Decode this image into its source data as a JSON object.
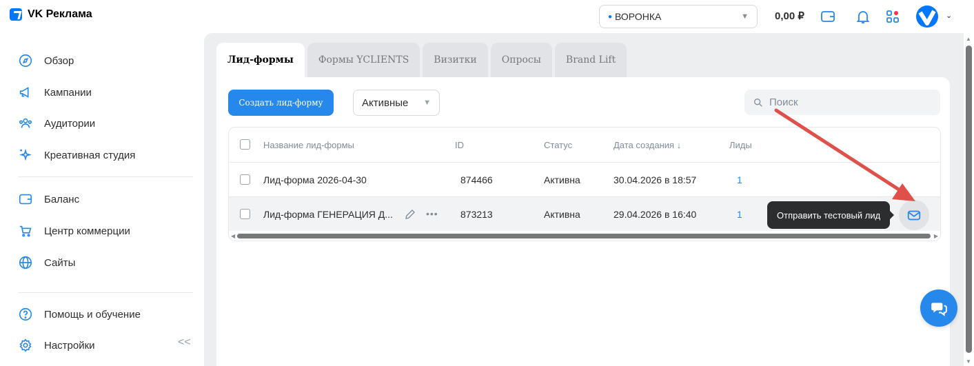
{
  "app": {
    "title": "VK Реклама"
  },
  "header": {
    "account": "ВОРОНКА",
    "balance": "0,00 ₽",
    "icons": [
      "wallet-icon",
      "bell-icon",
      "apps-icon",
      "avatar"
    ]
  },
  "sidebar": {
    "items": [
      {
        "label": "Обзор",
        "icon": "compass-icon"
      },
      {
        "label": "Кампании",
        "icon": "megaphone-icon"
      },
      {
        "label": "Аудитории",
        "icon": "users-icon"
      },
      {
        "label": "Креативная студия",
        "icon": "sparkle-icon"
      },
      {
        "label": "Баланс",
        "icon": "wallet-icon"
      },
      {
        "label": "Центр коммерции",
        "icon": "cart-icon"
      },
      {
        "label": "Сайты",
        "icon": "globe-icon"
      },
      {
        "label": "Помощь и обучение",
        "icon": "help-icon"
      },
      {
        "label": "Настройки",
        "icon": "gear-icon"
      }
    ],
    "collapse": "<<"
  },
  "tabs": [
    "Лид-формы",
    "Формы YCLIENTS",
    "Визитки",
    "Опросы",
    "Brand Lift"
  ],
  "toolbar": {
    "create_label": "Создать лид-форму",
    "filter_value": "Активные",
    "search_placeholder": "Поиск"
  },
  "table": {
    "columns": [
      "Название лид-формы",
      "ID",
      "Статус",
      "Дата создания ↓",
      "Лиды"
    ],
    "rows": [
      {
        "name": "Лид-форма 2026-04-30",
        "id": "874466",
        "status": "Активна",
        "date": "30.04.2026 в 18:57",
        "leads": "1"
      },
      {
        "name": "Лид-форма ГЕНЕРАЦИЯ Д...",
        "id": "873213",
        "status": "Активна",
        "date": "29.04.2026 в 16:40",
        "leads": "1"
      }
    ]
  },
  "tooltip": "Отправить тестовый лид",
  "colors": {
    "accent": "#2688eb",
    "brand": "#0077ff",
    "arrow": "#e0504a"
  }
}
